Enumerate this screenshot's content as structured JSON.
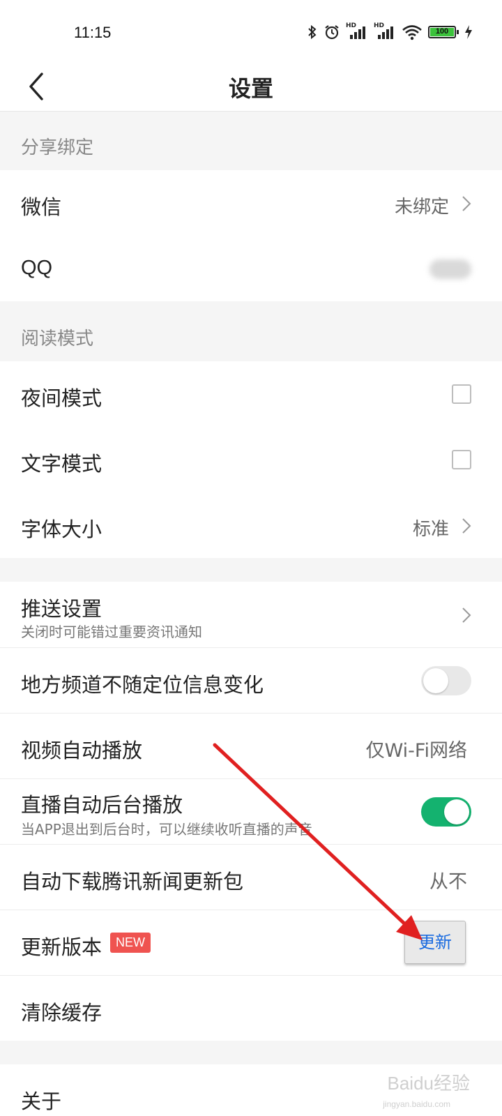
{
  "status": {
    "time": "11:15",
    "battery": "100",
    "hd1": "HD",
    "hd2": "HD"
  },
  "nav": {
    "title": "设置"
  },
  "sections": {
    "share": "分享绑定",
    "reading": "阅读模式"
  },
  "rows": {
    "wechat": {
      "label": "微信",
      "value": "未绑定"
    },
    "qq": {
      "label": "QQ"
    },
    "night": {
      "label": "夜间模式",
      "checked": false
    },
    "text": {
      "label": "文字模式",
      "checked": false
    },
    "font": {
      "label": "字体大小",
      "value": "标准"
    },
    "push": {
      "label": "推送设置",
      "sub": "关闭时可能错过重要资讯通知"
    },
    "local": {
      "label": "地方频道不随定位信息变化",
      "enabled": false
    },
    "video": {
      "label": "视频自动播放",
      "value": "仅Wi-Fi网络"
    },
    "live": {
      "label": "直播自动后台播放",
      "sub": "当APP退出到后台时，可以继续收听直播的声音",
      "enabled": true
    },
    "autodl": {
      "label": "自动下载腾讯新闻更新包",
      "value": "从不"
    },
    "update": {
      "label": "更新版本",
      "badge": "NEW",
      "button": "更新"
    },
    "cache": {
      "label": "清除缓存"
    },
    "about": {
      "label": "关于"
    }
  },
  "watermark": {
    "text": "Baidu经验",
    "sub": "jingyan.baidu.com"
  },
  "colors": {
    "toggle_on": "#14b26f",
    "badge": "#ef5350",
    "arrow": "#e02020",
    "link_blue": "#1a6be0"
  },
  "icons": [
    "bluetooth-icon",
    "alarm-icon",
    "signal-icon",
    "wifi-icon",
    "battery-icon",
    "charging-icon",
    "back-arrow-icon",
    "chevron-right-icon"
  ]
}
